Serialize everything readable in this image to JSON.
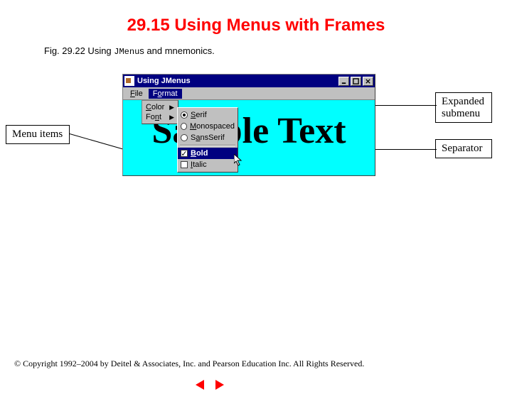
{
  "title": "29.15   Using Menus with Frames",
  "caption_prefix": "Fig. 29.22   Using ",
  "caption_code": "JMenu",
  "caption_suffix": "s and mnemonics.",
  "annotations": {
    "menu_items": "Menu items",
    "expanded_submenu": "Expanded submenu",
    "separator": "Separator"
  },
  "window": {
    "title": "Using JMenus",
    "menubar": {
      "file": "File",
      "format": "Format"
    },
    "sample_text": "Sample Text",
    "format_menu": {
      "color": "Color",
      "font": "Font"
    },
    "font_submenu": {
      "serif": "Serif",
      "monospaced": "Monospaced",
      "sansserif": "SansSerif",
      "bold": "Bold",
      "italic": "Italic"
    }
  },
  "copyright": "© Copyright 1992–2004 by Deitel & Associates, Inc. and Pearson Education Inc. All Rights Reserved."
}
